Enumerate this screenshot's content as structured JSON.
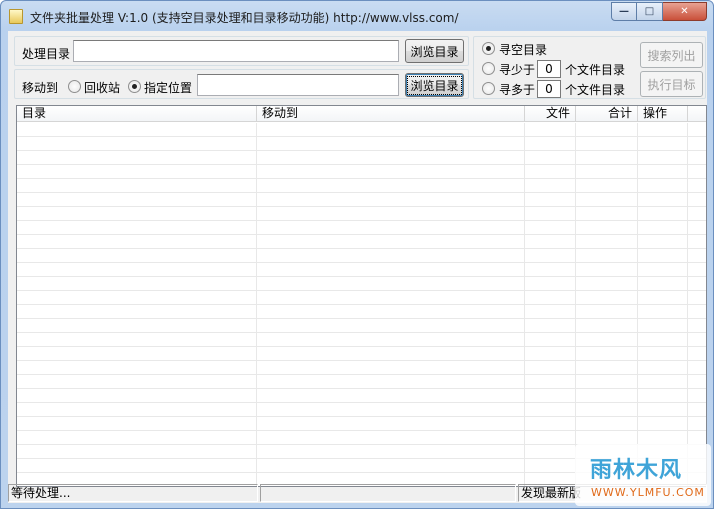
{
  "window": {
    "title": "文件夹批量处理 V:1.0 (支持空目录处理和目录移动功能) http://www.vlss.com/",
    "min_glyph": "—",
    "max_glyph": "□",
    "close_glyph": "✕"
  },
  "source": {
    "label": "处理目录",
    "value": "",
    "browse_label": "浏览目录"
  },
  "move": {
    "label": "移动到",
    "recycle_label": "回收站",
    "recycle_checked": false,
    "location_label": "指定位置",
    "location_checked": true,
    "location_value": "",
    "browse_label": "浏览目录"
  },
  "search_mode": {
    "empty_label": "寻空目录",
    "empty_checked": true,
    "less_label": "寻少于",
    "less_value": "0",
    "less_suffix": "个文件目录",
    "more_label": "寻多于",
    "more_value": "0",
    "more_suffix": "个文件目录"
  },
  "actions": {
    "search_label": "搜索列出",
    "execute_label": "执行目标"
  },
  "table": {
    "columns": [
      "目录",
      "移动到",
      "文件",
      "合计",
      "操作"
    ],
    "rows": []
  },
  "status": {
    "left": "等待处理...",
    "middle": "",
    "right": "发现最新版"
  },
  "watermark": {
    "main": "雨林木风",
    "sub": "WWW.YLMFU.COM"
  }
}
